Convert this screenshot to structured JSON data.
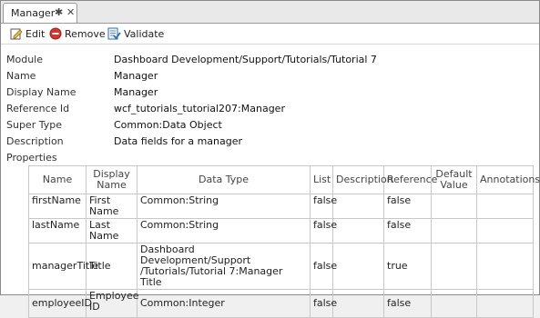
{
  "tab": {
    "title": "Manager",
    "pin_glyph": "✱",
    "close_glyph": "✕"
  },
  "toolbar": {
    "edit_label": "Edit",
    "remove_label": "Remove",
    "validate_label": "Validate"
  },
  "properties": {
    "module": {
      "label": "Module",
      "value": "Dashboard Development/Support/Tutorials/Tutorial 7"
    },
    "name": {
      "label": "Name",
      "value": "Manager"
    },
    "display_name": {
      "label": "Display Name",
      "value": "Manager"
    },
    "reference_id": {
      "label": "Reference Id",
      "value": "wcf_tutorials_tutorial207:Manager"
    },
    "super_type": {
      "label": "Super Type",
      "value": "Common:Data Object"
    },
    "description": {
      "label": "Description",
      "value": "Data fields for a manager"
    },
    "properties_label": "Properties"
  },
  "table": {
    "headers": {
      "name": "Name",
      "display_name": "Display Name",
      "data_type": "Data Type",
      "list": "List",
      "description": "Description",
      "reference": "Reference",
      "default_value": "Default Value",
      "annotations": "Annotations"
    },
    "rows": [
      {
        "name": "firstName",
        "display_name": "First Name",
        "data_type": "Common:String",
        "list": "false",
        "description": "",
        "reference": "false",
        "default_value": "",
        "annotations": ""
      },
      {
        "name": "lastName",
        "display_name": "Last Name",
        "data_type": "Common:String",
        "list": "false",
        "description": "",
        "reference": "false",
        "default_value": "",
        "annotations": ""
      },
      {
        "name": "managerTitle",
        "display_name": "Title",
        "data_type": "Dashboard Development/Support /Tutorials/Tutorial 7:Manager Title",
        "list": "false",
        "description": "",
        "reference": "true",
        "default_value": "",
        "annotations": ""
      },
      {
        "name": "employeeID",
        "display_name": "Employee ID",
        "data_type": "Common:Integer",
        "list": "false",
        "description": "",
        "reference": "false",
        "default_value": "",
        "annotations": ""
      }
    ]
  },
  "colors": {
    "remove_icon": "#d9342b",
    "accent": "#2f6db5"
  }
}
